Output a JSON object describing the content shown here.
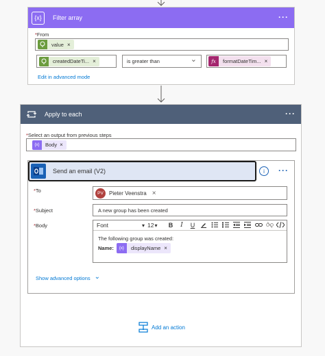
{
  "filter": {
    "title": "Filter array",
    "icon": "filter-array-icon",
    "from_label": "From",
    "from_token": "value",
    "left_token": "createdDateTi...",
    "operator": "is greater than",
    "right_token": "formatDateTim...",
    "advanced_link": "Edit in advanced mode",
    "accent": "#8c6cf2"
  },
  "apply": {
    "title": "Apply to each",
    "select_label": "Select an output from previous steps",
    "select_token": "Body",
    "accent": "#4f6079"
  },
  "email": {
    "title": "Send an email (V2)",
    "to_label": "To",
    "recipient_initials": "PV",
    "recipient_name": "Pieter Veenstra",
    "subject_label": "Subject",
    "subject_value": "A new group has been created",
    "body_label": "Body",
    "font": "Font",
    "font_size": "12",
    "body_line": "The following group was created:",
    "name_label": "Name:",
    "name_token": "displayName",
    "advanced_options": "Show advanced options",
    "accent": "#1a61b5"
  },
  "add_action": "Add an action",
  "glyphs": {
    "ellipsis": "···",
    "close": "×",
    "chevron": "⌄",
    "dropdown_arrow": "▾",
    "info": "i",
    "fx": "fx",
    "curly": "{x}",
    "bold": "B",
    "italic": "I",
    "underline": "U"
  }
}
